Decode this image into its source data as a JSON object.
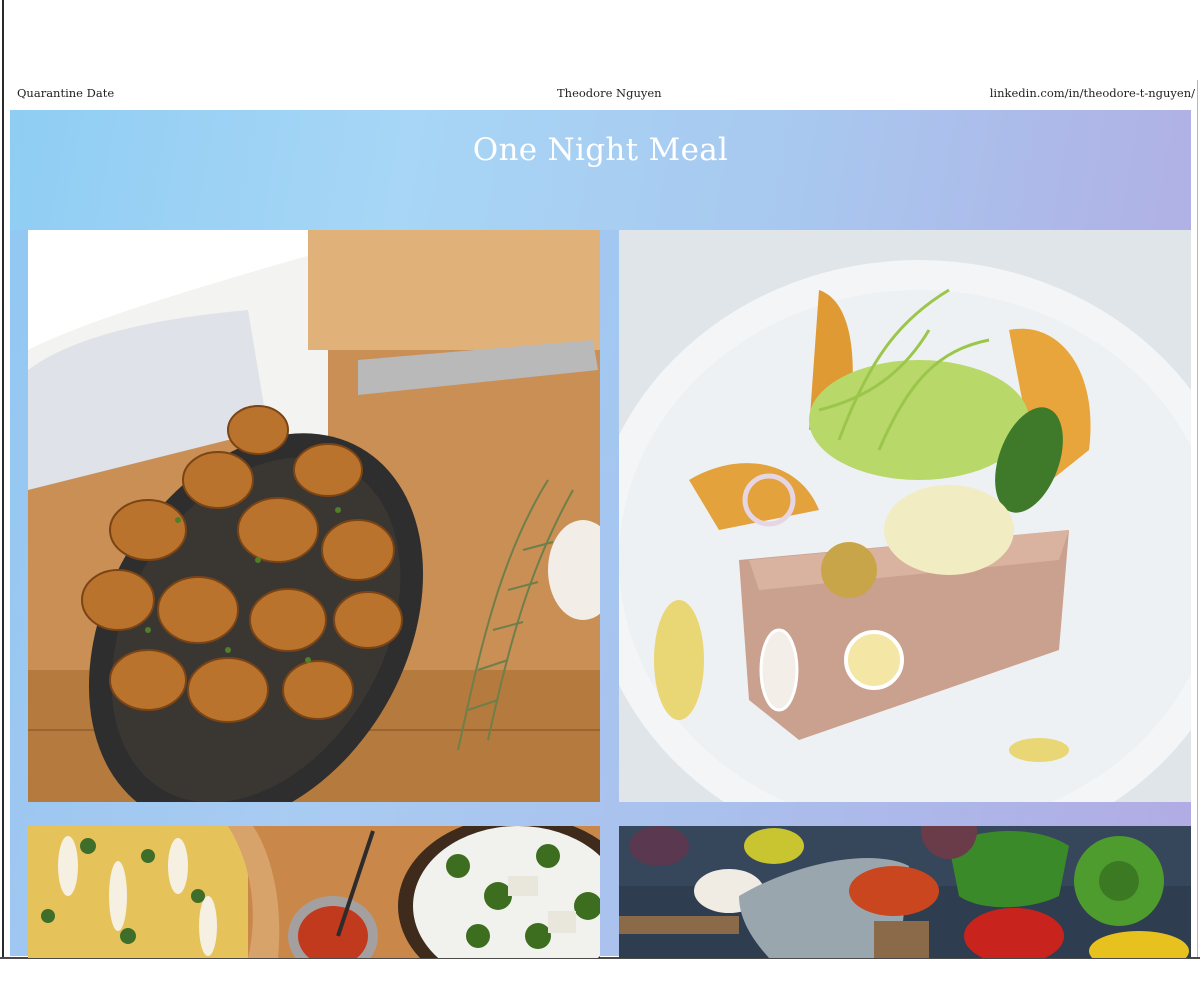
{
  "header": {
    "left_text": "Quarantine Date",
    "center_text": "Theodore Nguyen",
    "right_text": "linkedin.com/in/theodore-t-nguyen/"
  },
  "banner": {
    "title": "One Night Meal",
    "gradient_colors": [
      "#8fcdf3",
      "#a8c8ef",
      "#b3a9e2"
    ]
  },
  "gallery": {
    "photos": [
      {
        "subject": "roasted-potatoes-photo"
      },
      {
        "subject": "plated-terrine-photo"
      },
      {
        "subject": "pizza-and-greens-photo"
      },
      {
        "subject": "vegetables-and-cleaver-photo"
      }
    ]
  }
}
